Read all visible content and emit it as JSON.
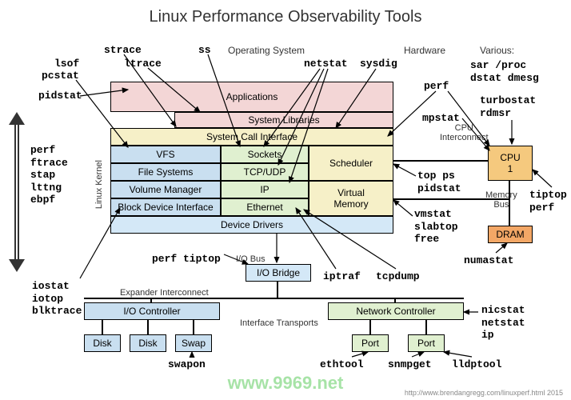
{
  "title": "Linux Performance Observability Tools",
  "labels": {
    "os": "Operating System",
    "hardware": "Hardware",
    "various": "Various:",
    "cpu_interconnect": "CPU\nInterconnect",
    "memory_bus": "Memory\nBus",
    "io_bus": "I/O Bus",
    "expander": "Expander Interconnect",
    "interface": "Interface Transports",
    "linux_kernel": "Linux Kernel"
  },
  "layers": {
    "applications": "Applications",
    "system_libraries": "System Libraries",
    "syscall": "System Call Interface",
    "vfs": "VFS",
    "filesystems": "File Systems",
    "volmgr": "Volume Manager",
    "blockdev": "Block Device Interface",
    "sockets": "Sockets",
    "tcpudp": "TCP/UDP",
    "ip": "IP",
    "ethernet": "Ethernet",
    "scheduler": "Scheduler",
    "virtmem": "Virtual\nMemory",
    "devdrv": "Device Drivers",
    "iobridge": "I/O Bridge",
    "ioctrl": "I/O Controller",
    "netctrl": "Network Controller",
    "disk": "Disk",
    "swap": "Swap",
    "port": "Port",
    "cpu1": "CPU\n1",
    "dram": "DRAM"
  },
  "tools": {
    "strace": "strace",
    "ltrace": "ltrace",
    "lsof": "lsof",
    "pcstat": "pcstat",
    "pidstat": "pidstat",
    "perf_ftrace": "perf\nftrace\nstap\nlttng\nebpf",
    "ss": "ss",
    "netstat": "netstat",
    "sysdig": "sysdig",
    "perf": "perf",
    "sar_proc": "sar /proc\ndstat dmesg",
    "turbostat": "turbostat\nrdmsr",
    "mpstat": "mpstat",
    "top_ps": "top ps\npidstat",
    "tiptop_perf": "tiptop\nperf",
    "vmstat": "vmstat\nslabtop\nfree",
    "numastat": "numastat",
    "iostat": "iostat\niotop\nblktrace",
    "perf_tiptop": "perf tiptop",
    "iptraf": "iptraf",
    "tcpdump": "tcpdump",
    "swapon": "swapon",
    "nicstat": "nicstat\nnetstat\nip",
    "ethtool": "ethtool",
    "snmpget": "snmpget",
    "lldptool": "lldptool"
  },
  "watermark": "www.9969.net",
  "cite": "http://www.brendangregg.com/linuxperf.html 2015"
}
